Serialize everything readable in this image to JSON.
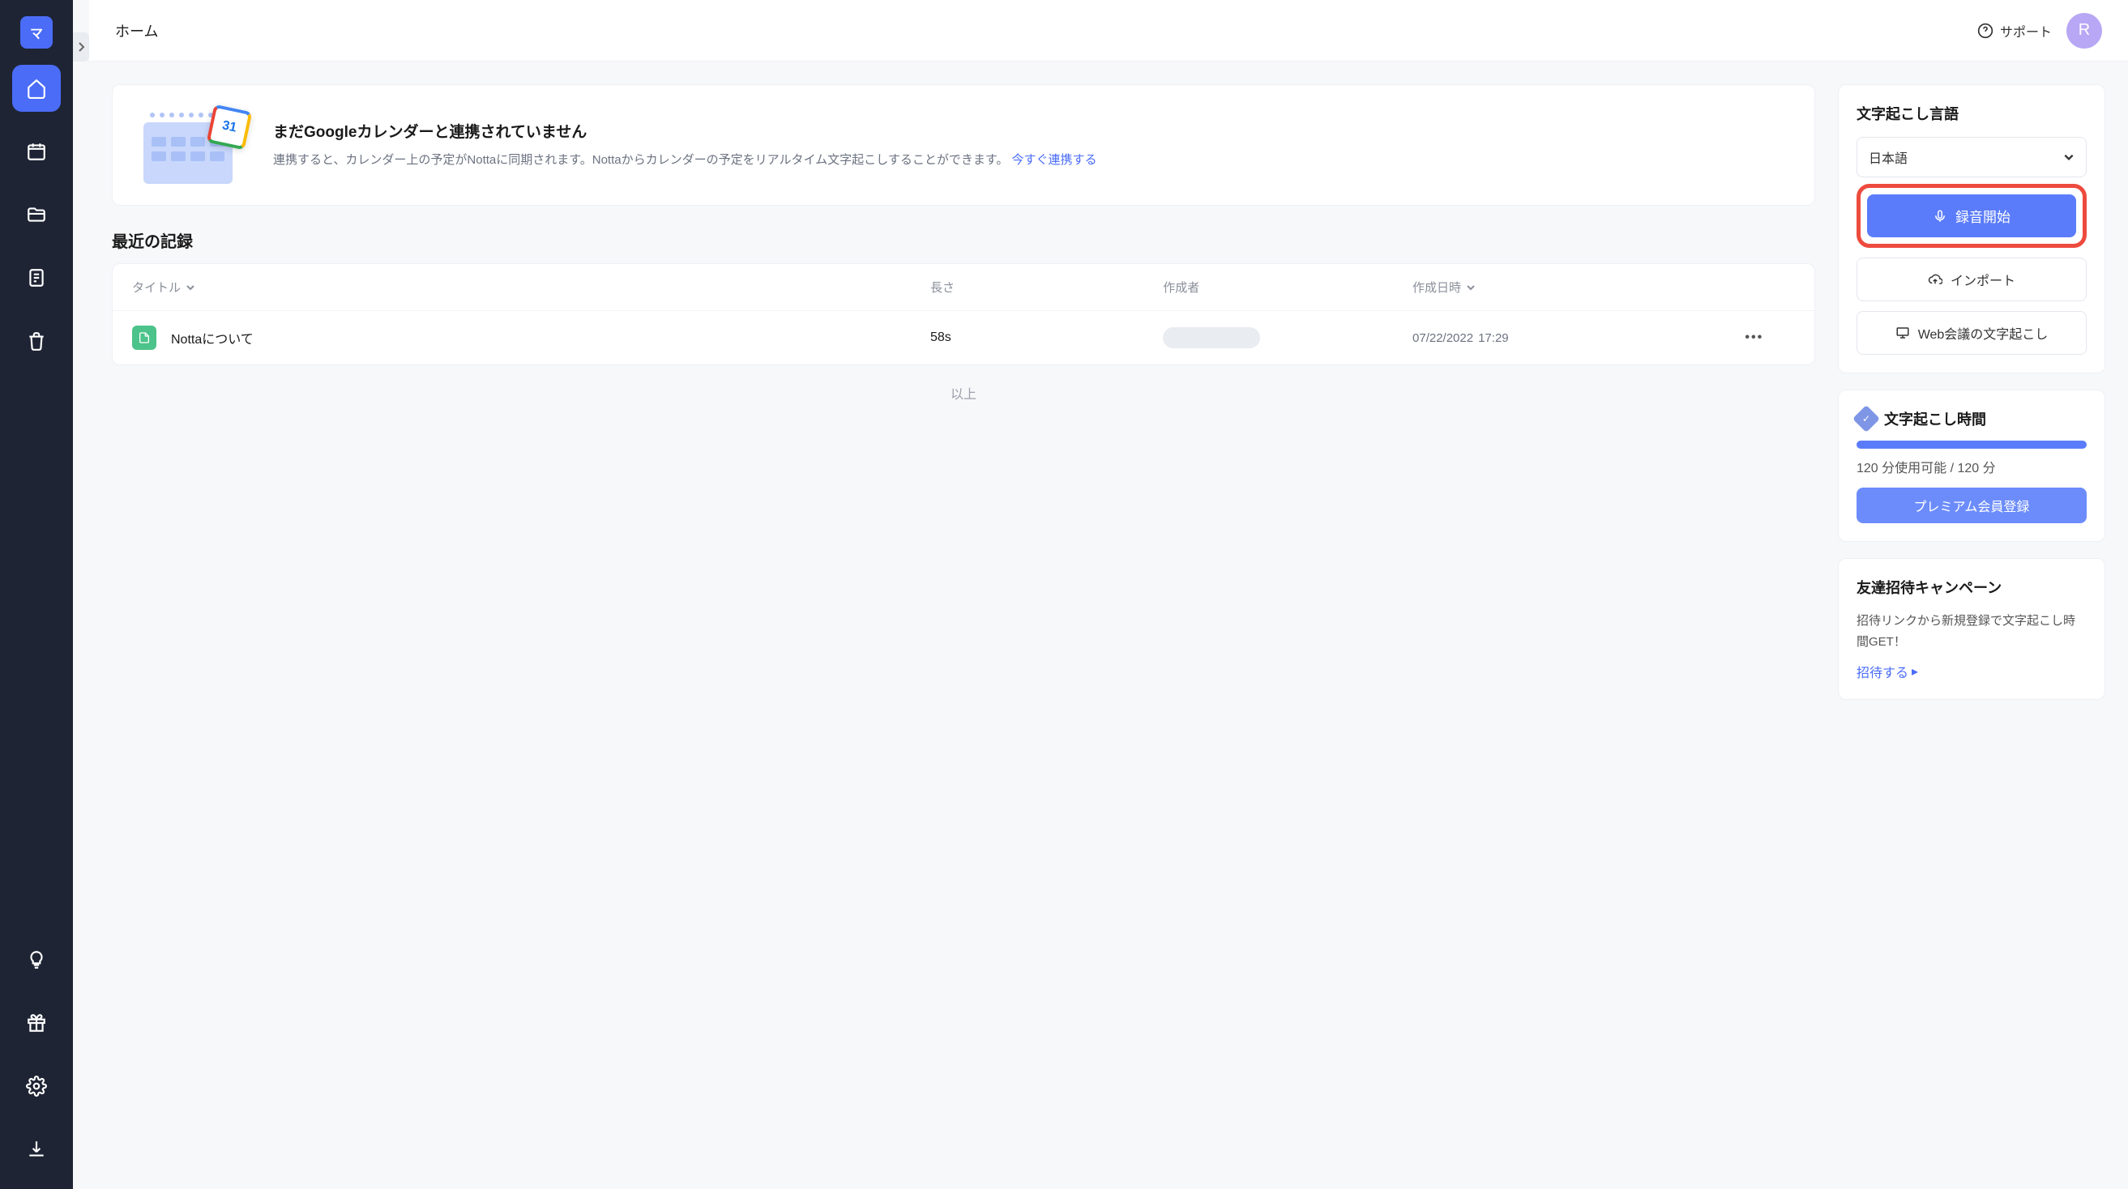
{
  "sidebar": {
    "logo_glyph": "マ"
  },
  "header": {
    "title": "ホーム",
    "support": "サポート",
    "avatar_initial": "R"
  },
  "banner": {
    "title": "まだGoogleカレンダーと連携されていません",
    "body": "連携すると、カレンダー上の予定がNottaに同期されます。Nottaからカレンダーの予定をリアルタイム文字起こしすることができます。",
    "link": "今すぐ連携する",
    "gcal_day": "31"
  },
  "records": {
    "heading": "最近の記録",
    "cols": {
      "title": "タイトル",
      "length": "長さ",
      "author": "作成者",
      "date": "作成日時"
    },
    "rows": [
      {
        "title": "Nottaについて",
        "length": "58s",
        "date_line1": "07/22/2022",
        "date_line2": "17:29"
      }
    ],
    "end": "以上"
  },
  "right": {
    "lang_title": "文字起こし言語",
    "lang_value": "日本語",
    "record_btn": "録音開始",
    "import_btn": "インポート",
    "web_btn": "Web会議の文字起こし",
    "time_title": "文字起こし時間",
    "usage": "120 分使用可能 / 120 分",
    "premium_btn": "プレミアム会員登録",
    "invite_title": "友達招待キャンペーン",
    "invite_desc": "招待リンクから新規登録で文字起こし時間GET！",
    "invite_link": "招待する"
  }
}
